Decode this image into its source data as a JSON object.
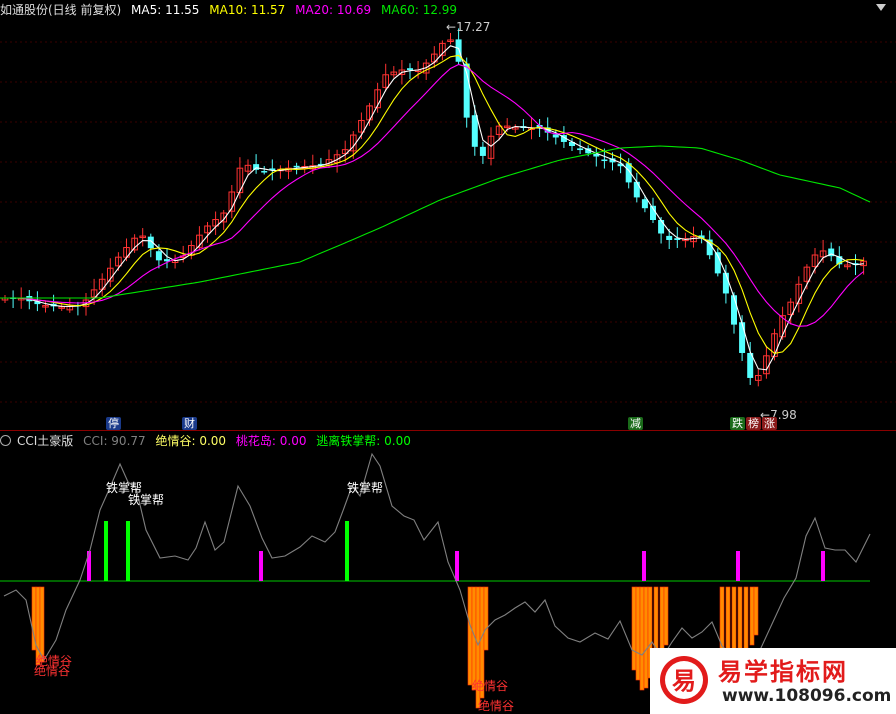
{
  "header": {
    "title": "如通股份(日线 前复权)",
    "ma5": "MA5: 11.55",
    "ma10": "MA10: 11.57",
    "ma20": "MA20: 10.69",
    "ma60": "MA60: 12.99"
  },
  "price_labels": {
    "high": "17.27",
    "low": "7.98"
  },
  "event_tags": [
    "停",
    "财",
    "减",
    "跌",
    "榜",
    "涨"
  ],
  "indicator": {
    "name": "CCI土豪版",
    "cci": "CCI: 90.77",
    "jueqinggu": "绝情谷: 0.00",
    "taohuadao": "桃花岛: 0.00",
    "taoli": "逃离铁掌帮: 0.00"
  },
  "signal_labels": {
    "tiezhangbang": "铁掌帮",
    "jueqinggu": "绝情谷"
  },
  "watermark": {
    "logo": "易",
    "title": "易学指标网",
    "url": "www.108096.com"
  },
  "colors": {
    "up": "#ff3232",
    "down": "#54ffff",
    "ma5": "#ffffff",
    "ma10": "#ffff00",
    "ma20": "#ff00ff",
    "ma60": "#00e600",
    "cci": "#808080",
    "zero": "#00c800",
    "green_bar": "#00ff00",
    "magenta_bar": "#ff00ff",
    "orange_bar": "#ff8c00"
  }
}
